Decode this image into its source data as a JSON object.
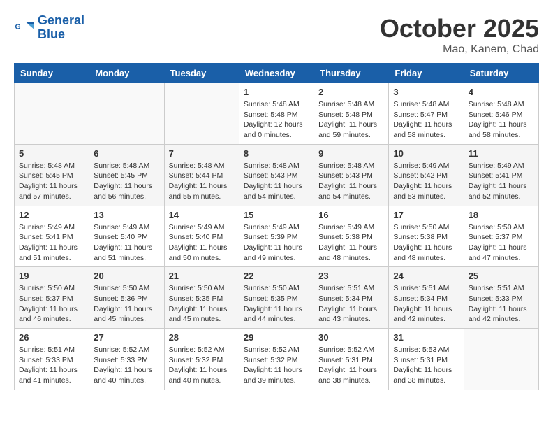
{
  "header": {
    "logo_line1": "General",
    "logo_line2": "Blue",
    "month": "October 2025",
    "location": "Mao, Kanem, Chad"
  },
  "weekdays": [
    "Sunday",
    "Monday",
    "Tuesday",
    "Wednesday",
    "Thursday",
    "Friday",
    "Saturday"
  ],
  "weeks": [
    [
      {
        "day": "",
        "info": ""
      },
      {
        "day": "",
        "info": ""
      },
      {
        "day": "",
        "info": ""
      },
      {
        "day": "1",
        "info": "Sunrise: 5:48 AM\nSunset: 5:48 PM\nDaylight: 12 hours\nand 0 minutes."
      },
      {
        "day": "2",
        "info": "Sunrise: 5:48 AM\nSunset: 5:48 PM\nDaylight: 11 hours\nand 59 minutes."
      },
      {
        "day": "3",
        "info": "Sunrise: 5:48 AM\nSunset: 5:47 PM\nDaylight: 11 hours\nand 58 minutes."
      },
      {
        "day": "4",
        "info": "Sunrise: 5:48 AM\nSunset: 5:46 PM\nDaylight: 11 hours\nand 58 minutes."
      }
    ],
    [
      {
        "day": "5",
        "info": "Sunrise: 5:48 AM\nSunset: 5:45 PM\nDaylight: 11 hours\nand 57 minutes."
      },
      {
        "day": "6",
        "info": "Sunrise: 5:48 AM\nSunset: 5:45 PM\nDaylight: 11 hours\nand 56 minutes."
      },
      {
        "day": "7",
        "info": "Sunrise: 5:48 AM\nSunset: 5:44 PM\nDaylight: 11 hours\nand 55 minutes."
      },
      {
        "day": "8",
        "info": "Sunrise: 5:48 AM\nSunset: 5:43 PM\nDaylight: 11 hours\nand 54 minutes."
      },
      {
        "day": "9",
        "info": "Sunrise: 5:48 AM\nSunset: 5:43 PM\nDaylight: 11 hours\nand 54 minutes."
      },
      {
        "day": "10",
        "info": "Sunrise: 5:49 AM\nSunset: 5:42 PM\nDaylight: 11 hours\nand 53 minutes."
      },
      {
        "day": "11",
        "info": "Sunrise: 5:49 AM\nSunset: 5:41 PM\nDaylight: 11 hours\nand 52 minutes."
      }
    ],
    [
      {
        "day": "12",
        "info": "Sunrise: 5:49 AM\nSunset: 5:41 PM\nDaylight: 11 hours\nand 51 minutes."
      },
      {
        "day": "13",
        "info": "Sunrise: 5:49 AM\nSunset: 5:40 PM\nDaylight: 11 hours\nand 51 minutes."
      },
      {
        "day": "14",
        "info": "Sunrise: 5:49 AM\nSunset: 5:40 PM\nDaylight: 11 hours\nand 50 minutes."
      },
      {
        "day": "15",
        "info": "Sunrise: 5:49 AM\nSunset: 5:39 PM\nDaylight: 11 hours\nand 49 minutes."
      },
      {
        "day": "16",
        "info": "Sunrise: 5:49 AM\nSunset: 5:38 PM\nDaylight: 11 hours\nand 48 minutes."
      },
      {
        "day": "17",
        "info": "Sunrise: 5:50 AM\nSunset: 5:38 PM\nDaylight: 11 hours\nand 48 minutes."
      },
      {
        "day": "18",
        "info": "Sunrise: 5:50 AM\nSunset: 5:37 PM\nDaylight: 11 hours\nand 47 minutes."
      }
    ],
    [
      {
        "day": "19",
        "info": "Sunrise: 5:50 AM\nSunset: 5:37 PM\nDaylight: 11 hours\nand 46 minutes."
      },
      {
        "day": "20",
        "info": "Sunrise: 5:50 AM\nSunset: 5:36 PM\nDaylight: 11 hours\nand 45 minutes."
      },
      {
        "day": "21",
        "info": "Sunrise: 5:50 AM\nSunset: 5:35 PM\nDaylight: 11 hours\nand 45 minutes."
      },
      {
        "day": "22",
        "info": "Sunrise: 5:50 AM\nSunset: 5:35 PM\nDaylight: 11 hours\nand 44 minutes."
      },
      {
        "day": "23",
        "info": "Sunrise: 5:51 AM\nSunset: 5:34 PM\nDaylight: 11 hours\nand 43 minutes."
      },
      {
        "day": "24",
        "info": "Sunrise: 5:51 AM\nSunset: 5:34 PM\nDaylight: 11 hours\nand 42 minutes."
      },
      {
        "day": "25",
        "info": "Sunrise: 5:51 AM\nSunset: 5:33 PM\nDaylight: 11 hours\nand 42 minutes."
      }
    ],
    [
      {
        "day": "26",
        "info": "Sunrise: 5:51 AM\nSunset: 5:33 PM\nDaylight: 11 hours\nand 41 minutes."
      },
      {
        "day": "27",
        "info": "Sunrise: 5:52 AM\nSunset: 5:33 PM\nDaylight: 11 hours\nand 40 minutes."
      },
      {
        "day": "28",
        "info": "Sunrise: 5:52 AM\nSunset: 5:32 PM\nDaylight: 11 hours\nand 40 minutes."
      },
      {
        "day": "29",
        "info": "Sunrise: 5:52 AM\nSunset: 5:32 PM\nDaylight: 11 hours\nand 39 minutes."
      },
      {
        "day": "30",
        "info": "Sunrise: 5:52 AM\nSunset: 5:31 PM\nDaylight: 11 hours\nand 38 minutes."
      },
      {
        "day": "31",
        "info": "Sunrise: 5:53 AM\nSunset: 5:31 PM\nDaylight: 11 hours\nand 38 minutes."
      },
      {
        "day": "",
        "info": ""
      }
    ]
  ]
}
